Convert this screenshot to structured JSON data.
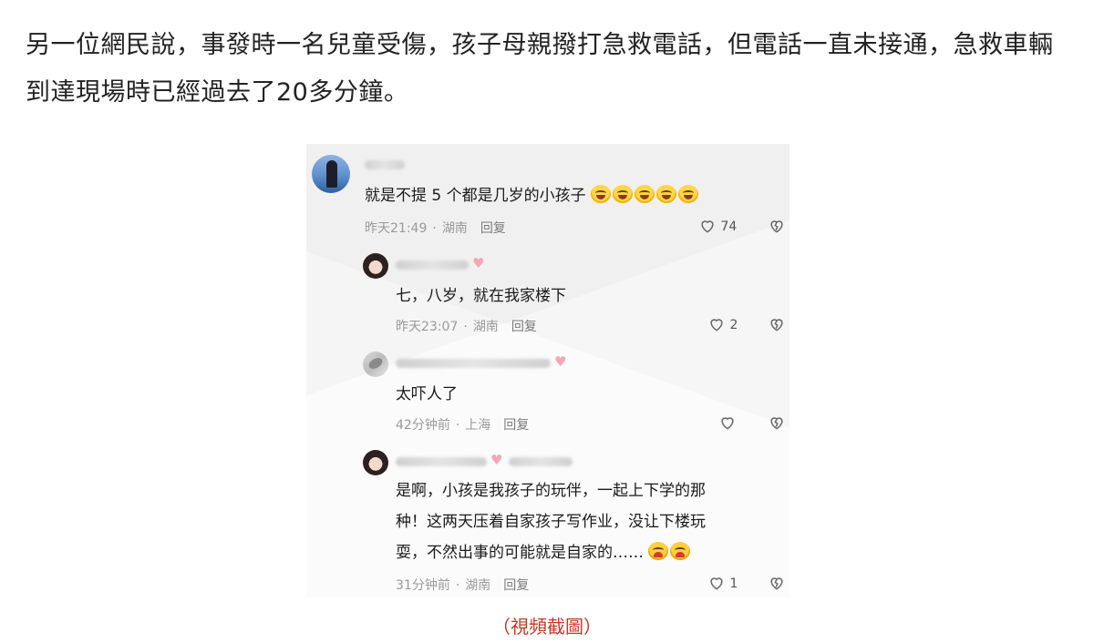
{
  "article": {
    "paragraph": "另一位網民說，事發時一名兒童受傷，孩子母親撥打急救電話，但電話一直未接通，急救車輛到達現場時已經過去了20多分鐘。",
    "caption": "（視頻截圖）"
  },
  "comments": [
    {
      "text_lines": [
        "就是不提 5 个都是几岁的小孩子"
      ],
      "emoji": "laughing-crying-face x5",
      "time": "昨天21:49",
      "location": "湖南",
      "reply_label": "回复",
      "likes": "74",
      "avatar": "sea-silhouette"
    },
    {
      "text_lines": [
        "七，八岁，就在我家楼下"
      ],
      "time": "昨天23:07",
      "location": "湖南",
      "reply_label": "回复",
      "likes": "2",
      "avatar": "girl-portrait"
    },
    {
      "text_lines": [
        "太吓人了"
      ],
      "time": "42分钟前",
      "location": "上海",
      "reply_label": "回复",
      "likes": "",
      "avatar": "hand-photo"
    },
    {
      "text_lines": [
        "是啊，小孩是我孩子的玩伴，一起上下学的那",
        "种！这两天压着自家孩子写作业，没让下楼玩",
        "耍，不然出事的可能就是自家的……"
      ],
      "emoji": "crying-face x2",
      "time": "31分钟前",
      "location": "湖南",
      "reply_label": "回复",
      "likes": "1",
      "avatar": "girl-portrait"
    }
  ],
  "colors": {
    "caption": "#c0392b",
    "meta_text": "#9a9a9a",
    "pink_heart": "#f5a6b8"
  }
}
